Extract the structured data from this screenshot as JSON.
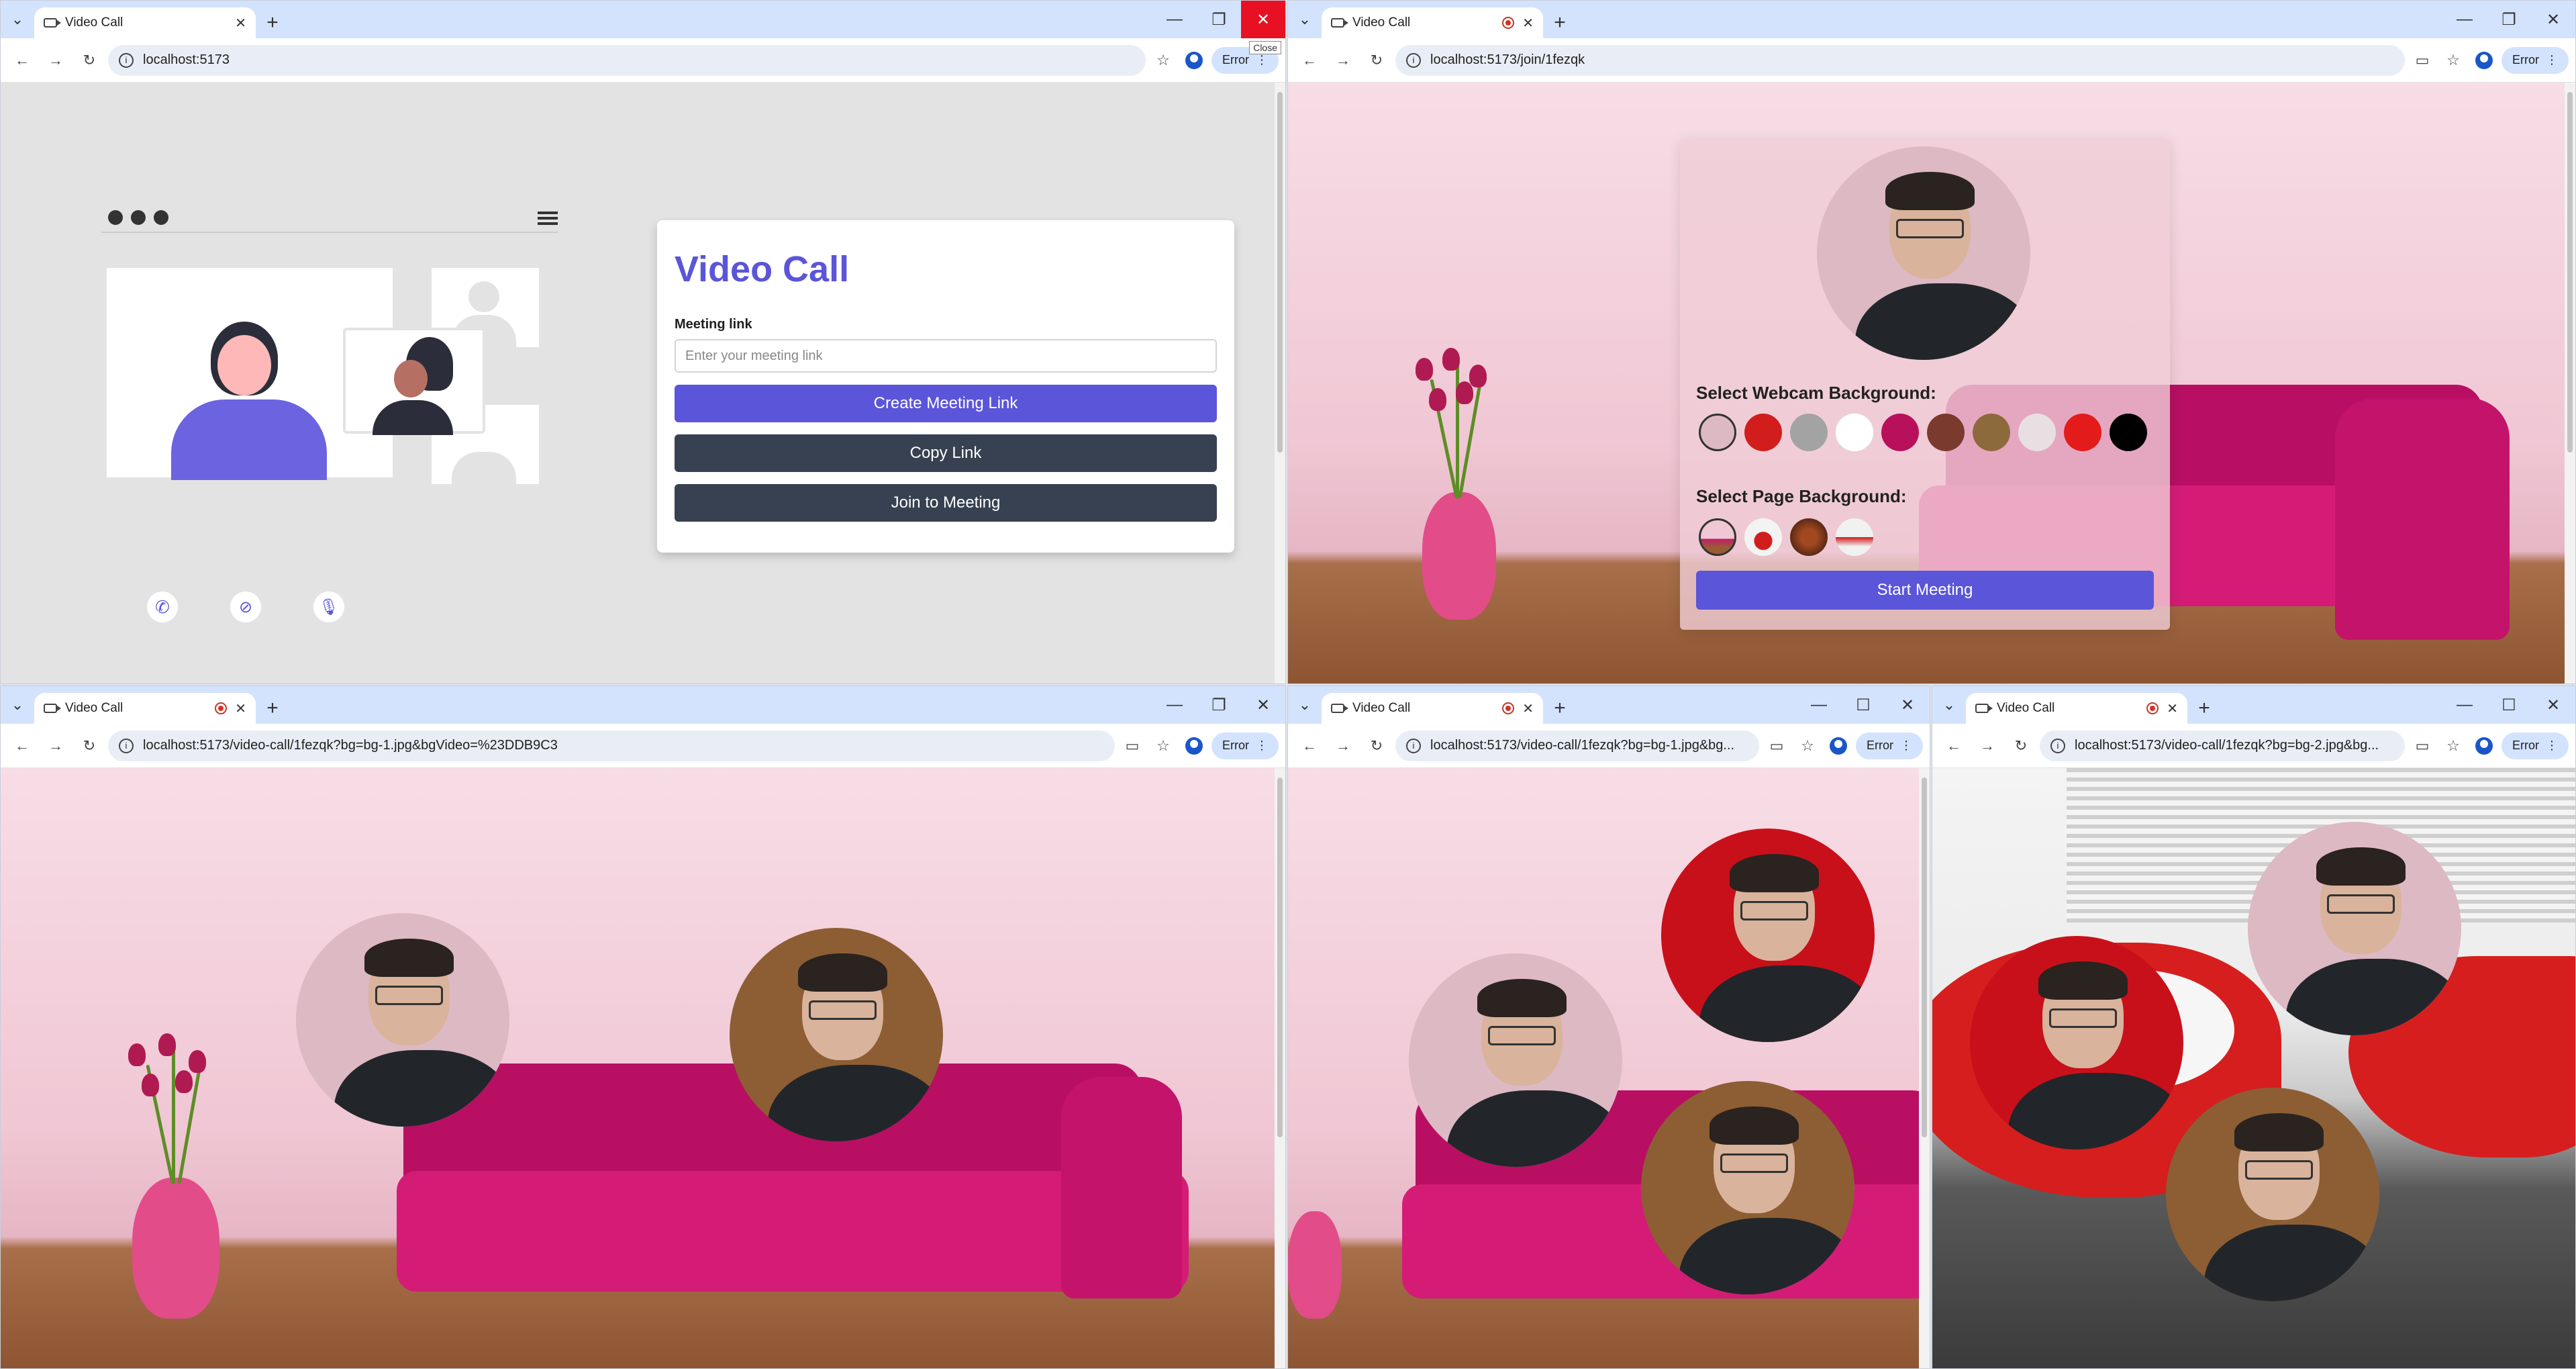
{
  "colors": {
    "accent": "#5b55d9",
    "dark_button": "#374151",
    "close_hover": "#e81123"
  },
  "icons": [
    "tab-menu-icon",
    "camera-icon",
    "recording-icon",
    "close-icon",
    "plus-icon",
    "minimize-icon",
    "maximize-icon",
    "back-icon",
    "forward-icon",
    "reload-icon",
    "info-icon",
    "star-icon",
    "profile-icon",
    "more-icon",
    "menu-icon",
    "phone-icon",
    "eye-off-icon",
    "mic-icon"
  ],
  "tab_title": "Video Call",
  "error_label": "Error",
  "close_tooltip": "Close",
  "windows": {
    "home": {
      "url": "localhost:5173"
    },
    "join": {
      "url": "localhost:5173/join/1fezqk"
    },
    "call_large": {
      "url": "localhost:5173/video-call/1fezqk?bg=bg-1.jpg&bgVideo=%23DDB9C3"
    },
    "call_small_1": {
      "url": "localhost:5173/video-call/1fezqk?bg=bg-1.jpg&bg..."
    },
    "call_small_2": {
      "url": "localhost:5173/video-call/1fezqk?bg=bg-2.jpg&bg..."
    }
  },
  "home": {
    "title": "Video Call",
    "meeting_link_label": "Meeting link",
    "meeting_link_placeholder": "Enter your meeting link",
    "create_button": "Create Meeting Link",
    "copy_button": "Copy Link",
    "join_button": "Join to Meeting"
  },
  "join": {
    "webcam_bg_label": "Select Webcam Background:",
    "webcam_colors": [
      "#ddb9c3",
      "#d21d1d",
      "#a3a3a3",
      "#ffffff",
      "#b8105a",
      "#7b3a2e",
      "#8d6a3c",
      "#e8dfe2",
      "#e41b1b",
      "#000000"
    ],
    "page_bg_label": "Select Page Background:",
    "page_backgrounds": [
      "bg-1",
      "bg-2",
      "bg-3",
      "bg-4"
    ],
    "start_button": "Start Meeting"
  },
  "call_large": {
    "participants": [
      {
        "bg": "#ddb9c3"
      },
      {
        "bg": "#8d5e33"
      }
    ]
  },
  "call_small_1": {
    "participants": [
      {
        "bg": "#c8101b"
      },
      {
        "bg": "#ddb9c3"
      },
      {
        "bg": "#8d5e33"
      }
    ]
  },
  "call_small_2": {
    "participants": [
      {
        "bg": "#ddb9c3"
      },
      {
        "bg": "#c8101b"
      },
      {
        "bg": "#8d5e33"
      }
    ]
  }
}
